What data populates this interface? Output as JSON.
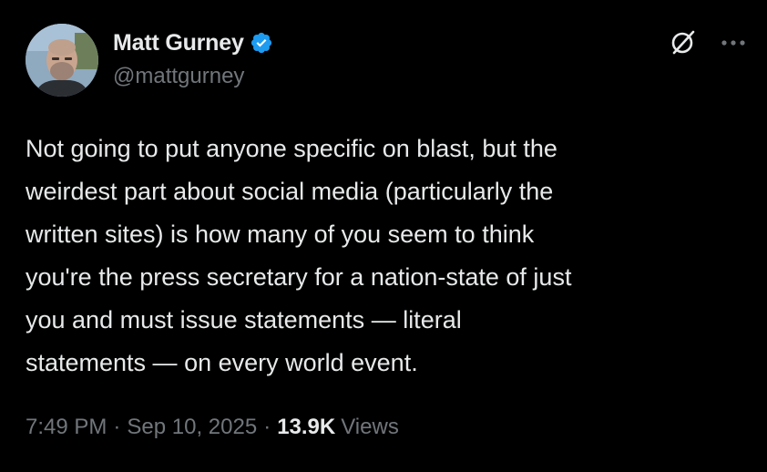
{
  "author": {
    "display_name": "Matt Gurney",
    "handle": "@mattgurney",
    "verified": true,
    "verified_color": "#1d9bf0"
  },
  "icons": {
    "verified": "verified-badge-icon",
    "grok": "grok-icon",
    "more": "more-options-icon"
  },
  "tweet": {
    "text": "Not going to put anyone specific on blast, but the\nweirdest part about social media (particularly the\nwritten sites) is how many of you seem to think\nyou're the press secretary for a nation-state of just\nyou and must issue statements — literal\nstatements — on every world event.",
    "time": "7:49 PM",
    "date": "Sep 10, 2025",
    "separator": "·",
    "views_count": "13.9K",
    "views_label": "Views"
  },
  "colors": {
    "background": "#000000",
    "text_primary": "#e7e9ea",
    "text_secondary": "#71767b"
  }
}
